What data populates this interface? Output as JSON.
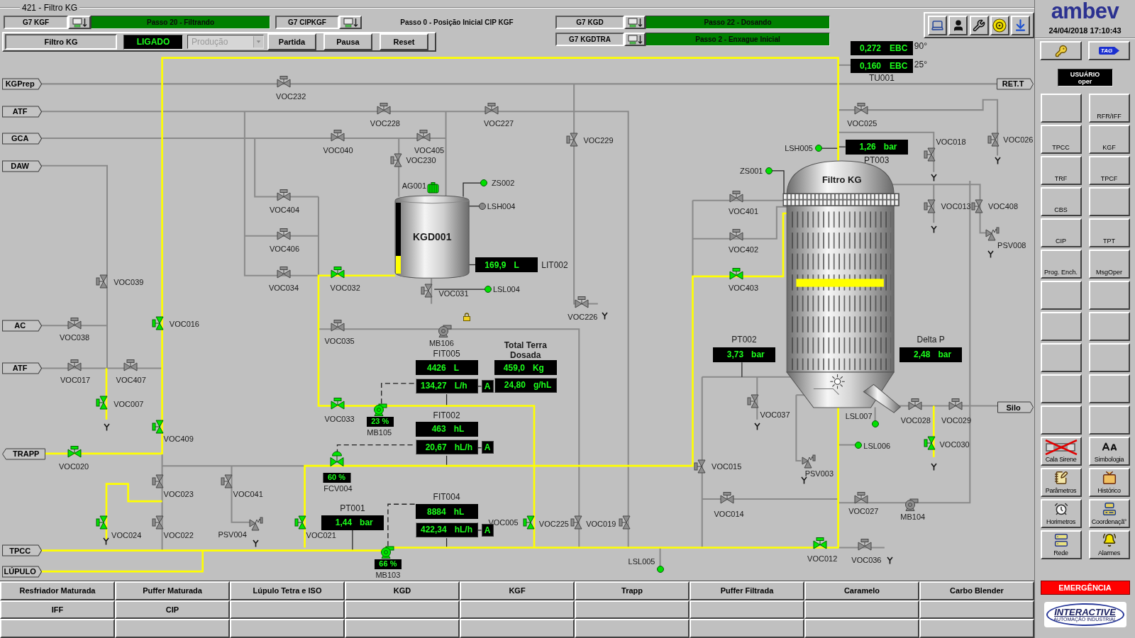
{
  "window": {
    "title": "421 - Filtro KG"
  },
  "sequences": [
    {
      "unit": "G7 KGF",
      "step": "Passo 20 - Filtrando",
      "active": true
    },
    {
      "unit": "G7 CIPKGF",
      "step": "Passo 0 - Posição Inicial CIP KGF",
      "active": false
    },
    {
      "unit": "G7 KGD",
      "step": "Passo 22 - Dosando",
      "active": true
    },
    {
      "unit": "G7 KGDTRA",
      "step": "Passo 2 - Enxague Inicial",
      "active": true
    }
  ],
  "control_panel": {
    "equipment": "Filtro KG",
    "status": "LIGADO",
    "mode": {
      "value": "Produção",
      "disabled": true
    },
    "buttons": [
      "Partida",
      "Pausa",
      "Reset"
    ]
  },
  "diagram": {
    "analyzer": {
      "tag": "TU001",
      "readings": [
        {
          "value": "0,272",
          "unit": "EBC",
          "temperature": "90°"
        },
        {
          "value": "0,160",
          "unit": "EBC",
          "temperature": "25°"
        }
      ]
    },
    "line_tags": [
      {
        "label": "KGPrep",
        "kind": "right"
      },
      {
        "label": "RET.T",
        "kind": "right"
      },
      {
        "label": "ATF",
        "kind": "right"
      },
      {
        "label": "GCA",
        "kind": "right"
      },
      {
        "label": "DAW",
        "kind": "right"
      },
      {
        "label": "AC",
        "kind": "right"
      },
      {
        "label": "ATF",
        "kind": "right"
      },
      {
        "label": "Silo",
        "kind": "right"
      },
      {
        "label": "TRAPP",
        "kind": "left"
      },
      {
        "label": "TPCC",
        "kind": "right"
      },
      {
        "label": "LÚPULO",
        "kind": "right"
      }
    ],
    "tank": {
      "tag": "KGD001",
      "level": 0.25,
      "agitator": {
        "tag": "AG001",
        "running": true
      }
    },
    "filter": {
      "title": "Filtro KG"
    },
    "valves": [
      {
        "tag": "VOC232",
        "kind": "onoff",
        "open": false
      },
      {
        "tag": "VOC228",
        "kind": "onoff",
        "open": false
      },
      {
        "tag": "VOC227",
        "kind": "onoff",
        "open": false
      },
      {
        "tag": "VOC025",
        "kind": "onoff",
        "open": false
      },
      {
        "tag": "VOC040",
        "kind": "onoff",
        "open": false
      },
      {
        "tag": "VOC405",
        "kind": "onoff",
        "open": false
      },
      {
        "tag": "VOC229",
        "kind": "onoff",
        "open": false
      },
      {
        "tag": "VOC026",
        "kind": "onoff",
        "open": false
      },
      {
        "tag": "VOC230",
        "kind": "onoff",
        "open": false
      },
      {
        "tag": "VOC018",
        "kind": "onoff",
        "open": false
      },
      {
        "tag": "VOC404",
        "kind": "onoff",
        "open": false
      },
      {
        "tag": "VOC401",
        "kind": "onoff",
        "open": false
      },
      {
        "tag": "VOC013",
        "kind": "onoff",
        "open": false
      },
      {
        "tag": "VOC408",
        "kind": "onoff",
        "open": false
      },
      {
        "tag": "VOC406",
        "kind": "onoff",
        "open": false
      },
      {
        "tag": "VOC402",
        "kind": "onoff",
        "open": false
      },
      {
        "tag": "PSV008",
        "kind": "relief",
        "open": false
      },
      {
        "tag": "VOC039",
        "kind": "onoff",
        "open": false
      },
      {
        "tag": "VOC034",
        "kind": "onoff",
        "open": false
      },
      {
        "tag": "VOC032",
        "kind": "onoff",
        "open": true
      },
      {
        "tag": "VOC031",
        "kind": "onoff",
        "open": false
      },
      {
        "tag": "VOC403",
        "kind": "onoff",
        "open": true
      },
      {
        "tag": "VOC226",
        "kind": "onoff",
        "open": false
      },
      {
        "tag": "VOC038",
        "kind": "onoff",
        "open": false
      },
      {
        "tag": "VOC016",
        "kind": "onoff",
        "open": true
      },
      {
        "tag": "VOC035",
        "kind": "onoff",
        "open": false
      },
      {
        "tag": "VOC017",
        "kind": "onoff",
        "open": false
      },
      {
        "tag": "VOC407",
        "kind": "onoff",
        "open": false
      },
      {
        "tag": "VOC007",
        "kind": "onoff",
        "open": true
      },
      {
        "tag": "VOC033",
        "kind": "onoff",
        "open": true
      },
      {
        "tag": "VOC037",
        "kind": "onoff",
        "open": false
      },
      {
        "tag": "VOC028",
        "kind": "onoff",
        "open": false
      },
      {
        "tag": "VOC029",
        "kind": "onoff",
        "open": false
      },
      {
        "tag": "VOC409",
        "kind": "onoff",
        "open": true
      },
      {
        "tag": "VOC020",
        "kind": "onoff",
        "open": true
      },
      {
        "tag": "VOC030",
        "kind": "onoff",
        "open": true
      },
      {
        "tag": "VOC015",
        "kind": "onoff",
        "open": false
      },
      {
        "tag": "PSV003",
        "kind": "relief",
        "open": false
      },
      {
        "tag": "VOC023",
        "kind": "onoff",
        "open": false
      },
      {
        "tag": "VOC041",
        "kind": "onoff",
        "open": false
      },
      {
        "tag": "VOC014",
        "kind": "onoff",
        "open": false
      },
      {
        "tag": "VOC027",
        "kind": "onoff",
        "open": false
      },
      {
        "tag": "VOC024",
        "kind": "onoff",
        "open": true
      },
      {
        "tag": "VOC022",
        "kind": "onoff",
        "open": false
      },
      {
        "tag": "PSV004",
        "kind": "relief",
        "open": false
      },
      {
        "tag": "VOC021",
        "kind": "onoff",
        "open": true
      },
      {
        "tag": "VOC005",
        "kind": "onoff",
        "open": true
      },
      {
        "tag": "VOC225",
        "kind": "onoff",
        "open": false
      },
      {
        "tag": "VOC019",
        "kind": "onoff",
        "open": false
      },
      {
        "tag": "VOC012",
        "kind": "onoff",
        "open": true
      },
      {
        "tag": "VOC036",
        "kind": "onoff",
        "open": false
      }
    ],
    "pumps": [
      {
        "tag": "MB106",
        "running": false
      },
      {
        "tag": "MB105",
        "running": true,
        "speed": "23 %"
      },
      {
        "tag": "MB104",
        "running": false
      },
      {
        "tag": "MB103",
        "running": true,
        "speed": "66 %"
      }
    ],
    "control_valves": [
      {
        "tag": "FCV004",
        "open": true,
        "opening": "60 %"
      }
    ],
    "sensors": [
      {
        "tag": "LSH005",
        "active": true
      },
      {
        "tag": "ZS001",
        "active": true
      },
      {
        "tag": "ZS002",
        "active": true
      },
      {
        "tag": "LSH004",
        "active": false
      },
      {
        "tag": "LSL004",
        "active": true
      },
      {
        "tag": "LSL007",
        "active": true
      },
      {
        "tag": "LSL006",
        "active": true
      },
      {
        "tag": "LSL005",
        "active": true
      }
    ],
    "readouts": [
      {
        "label": "PT003",
        "values": [
          {
            "value": "1,26",
            "unit": "bar"
          }
        ]
      },
      {
        "label": "LIT002",
        "values": [
          {
            "value": "169,9",
            "unit": "L"
          }
        ]
      },
      {
        "label": "FIT005",
        "values": [
          {
            "value": "4426",
            "unit": "L"
          },
          {
            "value": "134,27",
            "unit": "L/h"
          }
        ],
        "mode": "A"
      },
      {
        "label": "Total Terra Dosada",
        "values": [
          {
            "value": "459,0",
            "unit": "Kg"
          },
          {
            "value": "24,80",
            "unit": "g/hL"
          }
        ]
      },
      {
        "label": "PT002",
        "values": [
          {
            "value": "3,73",
            "unit": "bar"
          }
        ]
      },
      {
        "label": "Delta P",
        "values": [
          {
            "value": "2,48",
            "unit": "bar"
          }
        ]
      },
      {
        "label": "FIT002",
        "values": [
          {
            "value": "463",
            "unit": "hL"
          },
          {
            "value": "20,67",
            "unit": "hL/h"
          }
        ],
        "mode": "A"
      },
      {
        "label": "PT001",
        "values": [
          {
            "value": "1,44",
            "unit": "bar"
          }
        ]
      },
      {
        "label": "FIT004",
        "values": [
          {
            "value": "8884",
            "unit": "hL"
          },
          {
            "value": "422,34",
            "unit": "hL/h"
          }
        ],
        "mode": "A"
      }
    ]
  },
  "bottom_nav": [
    "Resfriador Maturada",
    "Puffer Maturada",
    "Lúpulo Tetra e ISO",
    "KGD",
    "KGF",
    "Trapp",
    "Puffer Filtrada",
    "Caramelo",
    "Carbo Blender",
    "IFF",
    "CIP"
  ],
  "sidebar": {
    "logo": "ambev",
    "datetime": "24/04/2018 17:10:43",
    "tag_button": "TAG",
    "user": {
      "title": "USUÁRIO",
      "name": "oper"
    },
    "buttons": [
      {
        "kind": "blank"
      },
      {
        "kind": "text",
        "label": "RFR/IFF"
      },
      {
        "kind": "text",
        "label": "TPCC"
      },
      {
        "kind": "text",
        "label": "KGF"
      },
      {
        "kind": "text",
        "label": "TRF"
      },
      {
        "kind": "text",
        "label": "TPCF"
      },
      {
        "kind": "text",
        "label": "CBS"
      },
      {
        "kind": "blank"
      },
      {
        "kind": "text",
        "label": "CIP"
      },
      {
        "kind": "text",
        "label": "TPT"
      },
      {
        "kind": "text",
        "label": "Prog. Ench."
      },
      {
        "kind": "text",
        "label": "MsgOper"
      },
      {
        "kind": "blank"
      },
      {
        "kind": "blank"
      },
      {
        "kind": "blank"
      },
      {
        "kind": "blank"
      },
      {
        "kind": "blank"
      },
      {
        "kind": "blank"
      },
      {
        "kind": "blank"
      },
      {
        "kind": "blank"
      },
      {
        "kind": "blank"
      },
      {
        "kind": "blank"
      },
      {
        "kind": "icon",
        "label": "Cala Sirene"
      },
      {
        "kind": "icon",
        "label": "Simbologia"
      },
      {
        "kind": "icon",
        "label": "Parâmetros"
      },
      {
        "kind": "icon",
        "label": "Histórico"
      },
      {
        "kind": "icon",
        "label": "Horimetros"
      },
      {
        "kind": "icon",
        "label": "Coordenaçã°"
      },
      {
        "kind": "icon",
        "label": "Rede"
      },
      {
        "kind": "icon",
        "label": "Alarmes"
      }
    ],
    "emergency": "EMERGÊNCIA",
    "vendor_logo": {
      "name": "INTERACTIVE",
      "tagline": "AUTOMAÇÃO INDUSTRIAL"
    }
  }
}
